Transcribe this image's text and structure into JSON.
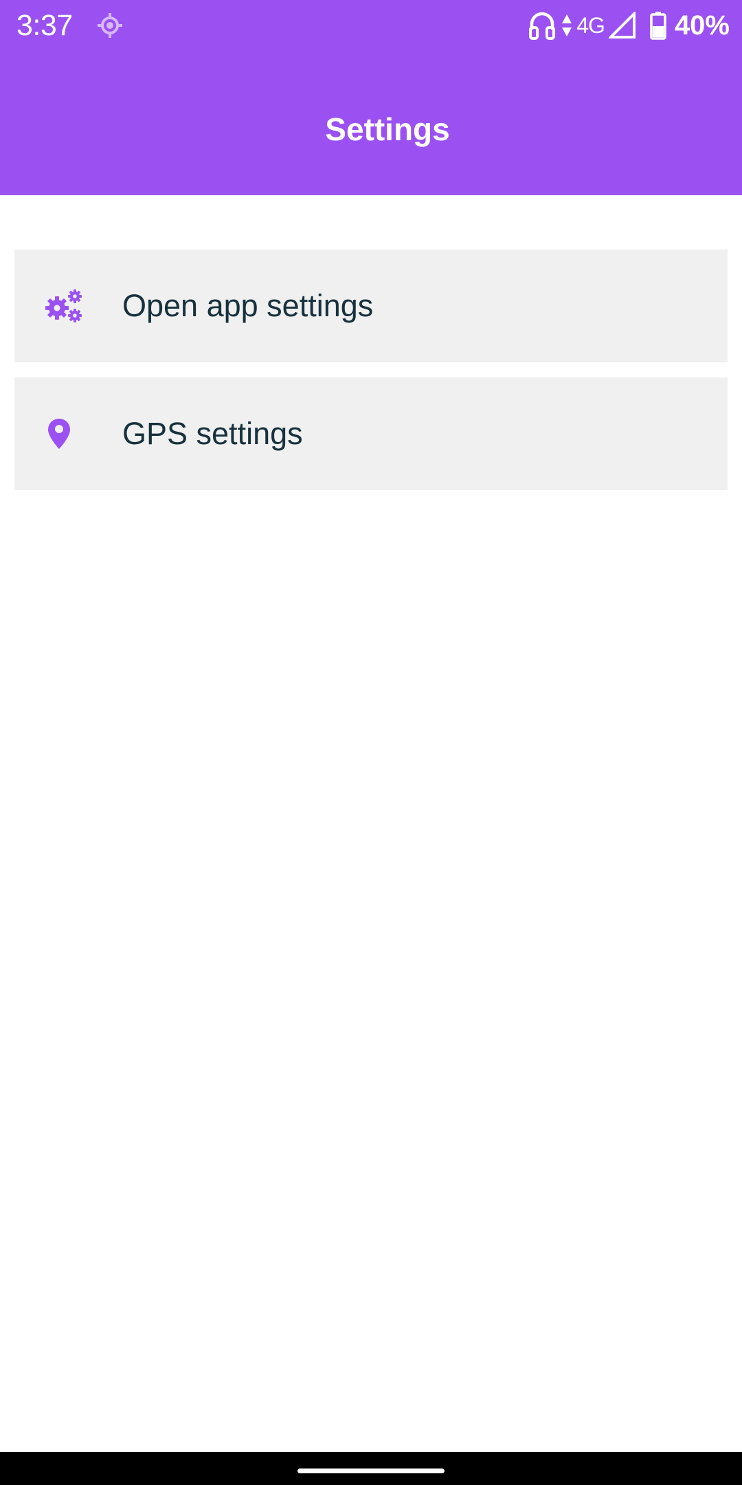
{
  "status_bar": {
    "time": "3:37",
    "network_type": "4G",
    "battery": "40%",
    "icons": [
      "location-icon",
      "headphones-icon",
      "data-activity-icon",
      "signal-icon",
      "battery-icon"
    ]
  },
  "header": {
    "title": "Settings",
    "color": "#9b51f2"
  },
  "settings": {
    "items": [
      {
        "label": "Open app settings",
        "icon": "gears-icon"
      },
      {
        "label": "GPS settings",
        "icon": "location-pin-icon"
      }
    ]
  },
  "colors": {
    "accent": "#9b51f2",
    "item_background": "#f0f0f0",
    "item_text": "#17313d"
  }
}
